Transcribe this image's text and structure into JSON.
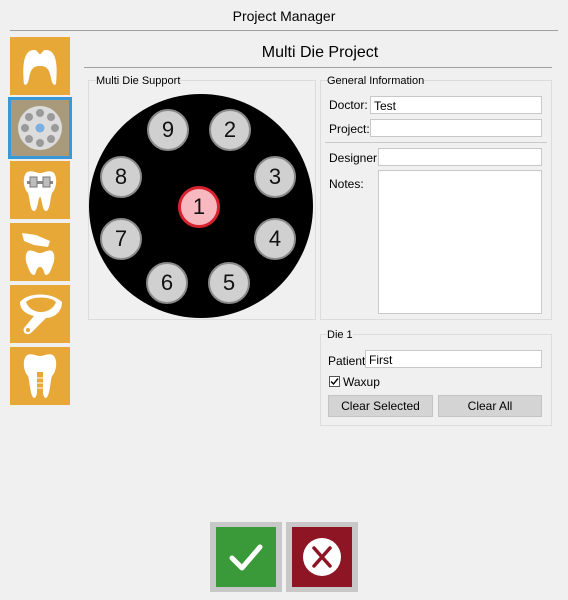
{
  "window": {
    "title": "Project Manager"
  },
  "page": {
    "subtitle": "Multi Die Project"
  },
  "sidebar": {
    "items": [
      {
        "icon": "crown-tooth-icon",
        "selected": false
      },
      {
        "icon": "multi-die-plate-icon",
        "selected": true
      },
      {
        "icon": "orthodontic-bracket-tooth-icon",
        "selected": false
      },
      {
        "icon": "bridge-tooth-icon",
        "selected": false
      },
      {
        "icon": "impression-tray-icon",
        "selected": false
      },
      {
        "icon": "implant-tooth-icon",
        "selected": false
      }
    ]
  },
  "multi_die": {
    "label": "Multi Die Support",
    "dies": [
      "1",
      "2",
      "3",
      "4",
      "5",
      "6",
      "7",
      "8",
      "9"
    ],
    "selected": "1",
    "colors": {
      "plate": "#000000",
      "die": "#d0d0d0",
      "active_fill": "#f7b8c0",
      "active_border": "#d8222e"
    }
  },
  "general_info": {
    "label": "General Information",
    "doctor_label": "Doctor:",
    "doctor_value": "Test",
    "project_label": "Project:",
    "project_value": "",
    "designer_label": "Designer:",
    "designer_value": "",
    "notes_label": "Notes:",
    "notes_value": ""
  },
  "die_panel": {
    "label": "Die 1",
    "patient_label": "Patient",
    "patient_value": "First",
    "waxup_label": "Waxup",
    "waxup_checked": true,
    "clear_selected_label": "Clear Selected",
    "clear_all_label": "Clear All"
  },
  "footer": {
    "ok_icon": "checkmark-icon",
    "cancel_icon": "x-icon",
    "colors": {
      "ok": "#3a9a3a",
      "cancel": "#8e1524"
    }
  }
}
